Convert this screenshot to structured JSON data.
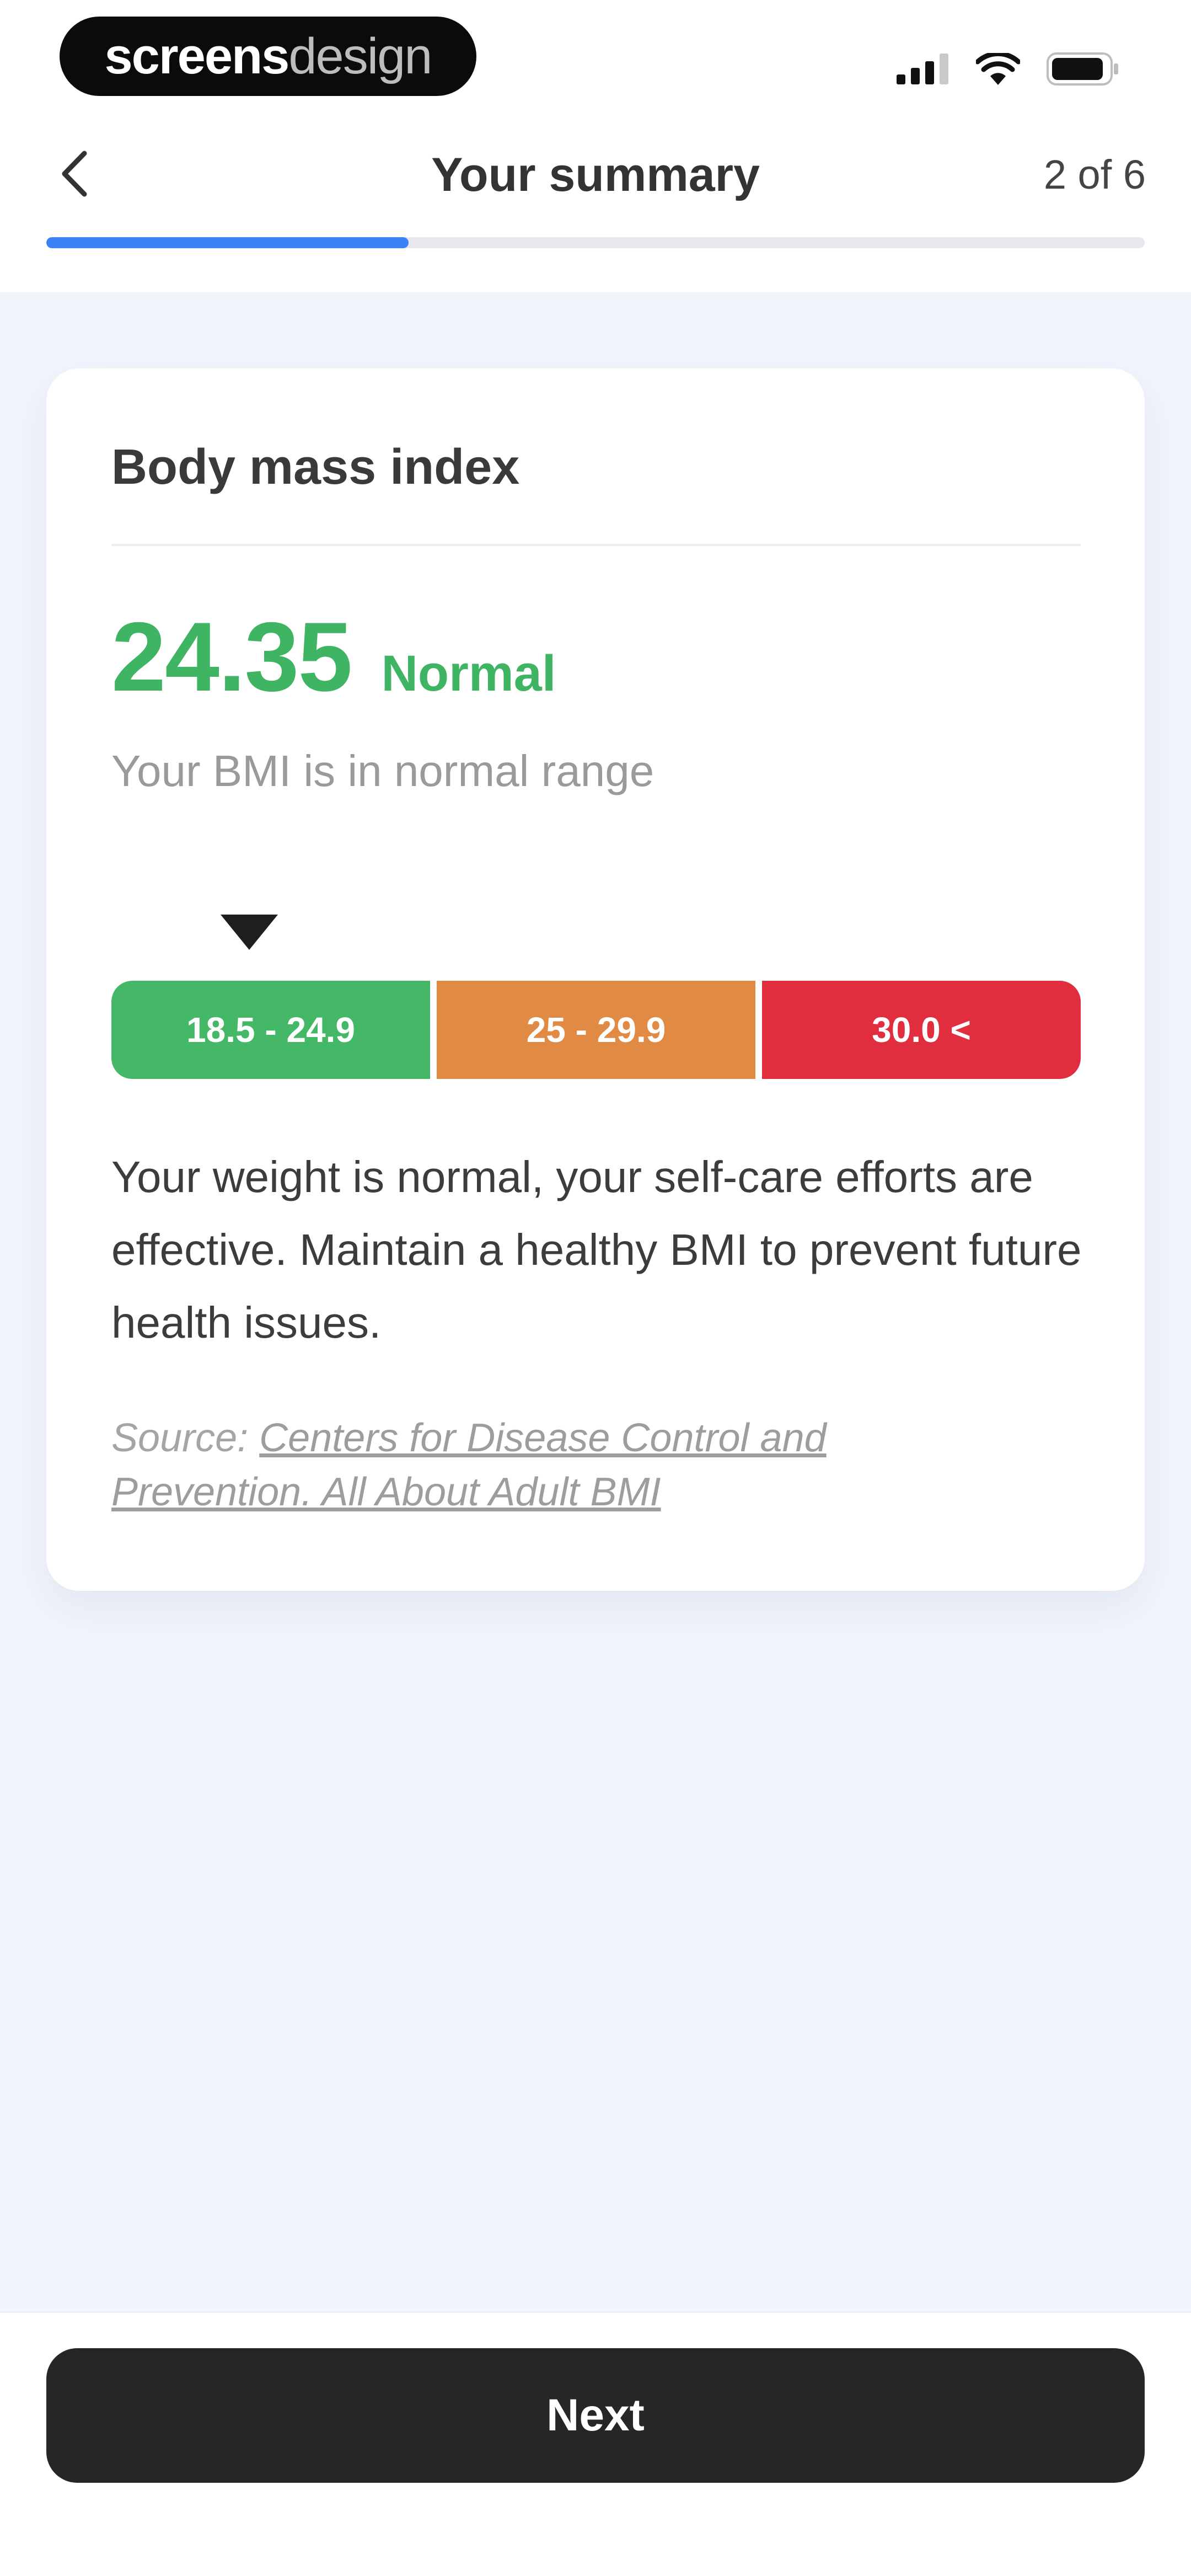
{
  "status_bar": {
    "brand_part1": "screens",
    "brand_part2": "design",
    "icons": [
      "cellular-signal-icon",
      "wifi-icon",
      "battery-icon"
    ]
  },
  "header": {
    "title": "Your summary",
    "step": "2 of 6",
    "progress_fraction": 0.33,
    "back_icon": "chevron-left-icon"
  },
  "card": {
    "title": "Body mass index",
    "bmi_value": "24.35",
    "bmi_status": "Normal",
    "subtitle": "Your BMI is in normal range",
    "scale": {
      "segments": [
        {
          "label": "18.5 - 24.9",
          "color": "#44b866"
        },
        {
          "label": "25 - 29.9",
          "color": "#e08a44"
        },
        {
          "label": "30.0 <",
          "color": "#e12e3f"
        }
      ],
      "pointer_icon": "triangle-down-icon"
    },
    "description": "Your weight is normal, your self-care efforts are effective. Maintain a healthy BMI to prevent future health issues.",
    "source_prefix": "Source:",
    "source_link": "Centers for Disease Control and Prevention. All About Adult BMI"
  },
  "footer": {
    "next_label": "Next"
  },
  "colors": {
    "accent": "#3c82f6",
    "normal": "#3fb564",
    "button_bg": "#262626",
    "body_bg": "#f1f5fc"
  }
}
